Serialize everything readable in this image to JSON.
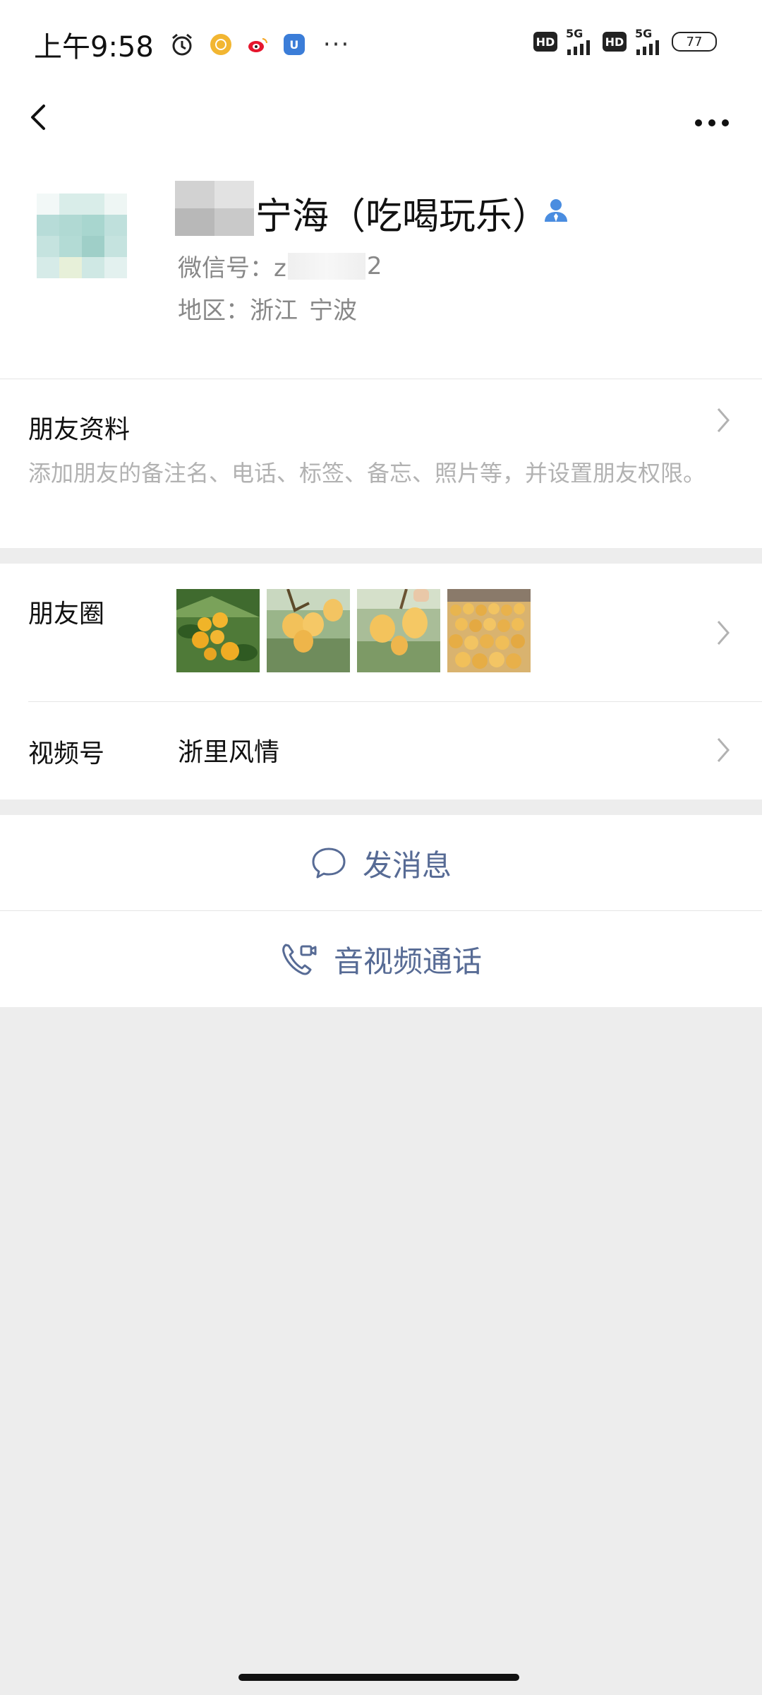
{
  "status_bar": {
    "time": "上午9:58",
    "more_glyph": "···",
    "hd_label": "HD",
    "network_label": "5G",
    "battery": "77"
  },
  "nav": {
    "back_icon": "chevron-left-icon",
    "more_icon": "more-horizontal-icon"
  },
  "profile": {
    "nickname": "宁海（吃喝玩乐）",
    "wechat_id_prefix": "微信号：z",
    "wechat_id_suffix": "2",
    "region_label": "地区：",
    "region_province": "浙江",
    "region_city": "宁波"
  },
  "friend_info": {
    "title": "朋友资料",
    "description": "添加朋友的备注名、电话、标签、备忘、照片等，并设置朋友权限。"
  },
  "moments": {
    "label": "朋友圈",
    "thumbnails": [
      "loquat-branch",
      "loquat-cluster",
      "loquat-hand",
      "loquat-pile"
    ]
  },
  "channels": {
    "label": "视频号",
    "name": "浙里风情"
  },
  "actions": {
    "message": "发消息",
    "call": "音视频通话"
  },
  "colors": {
    "link": "#576b95",
    "background": "#ededed",
    "secondary_text": "#888888",
    "hint_text": "#b2b2b2"
  }
}
